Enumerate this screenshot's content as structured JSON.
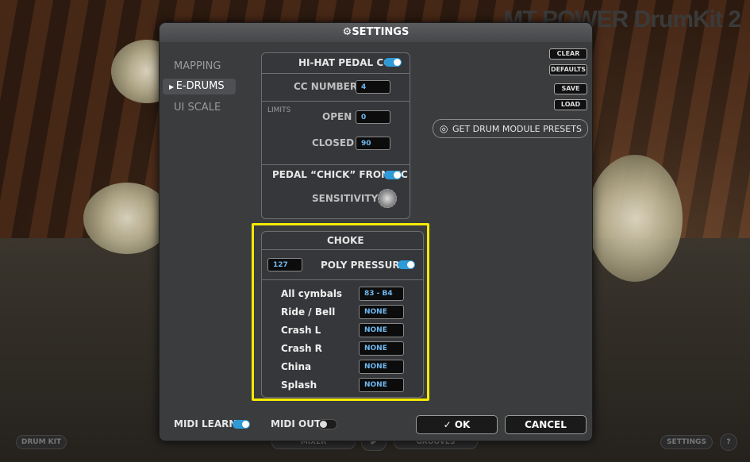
{
  "background": {
    "brand": "MT POWER DrumKit 2",
    "bottom_left_button": "DRUM KIT",
    "bottom_mixer": "MIXER",
    "bottom_grooves": "GROOVES",
    "bottom_settings": "SETTINGS",
    "bottom_help": "?"
  },
  "dialog": {
    "title": "SETTINGS",
    "nav": [
      {
        "label": "MAPPING",
        "active": false
      },
      {
        "label": "E-DRUMS",
        "active": true
      },
      {
        "label": "UI SCALE",
        "active": false
      }
    ],
    "hihat": {
      "pedal_cc_label": "HI-HAT PEDAL CC",
      "pedal_cc_on": true,
      "cc_number_label": "CC NUMBER",
      "cc_number_value": "4",
      "limits_label": "LIMITS",
      "open_label": "OPEN",
      "open_value": "0",
      "closed_label": "CLOSED",
      "closed_value": "90",
      "chick_label": "PEDAL “CHICK” FROM CC",
      "chick_on": true,
      "sensitivity_label": "SENSITIVITY"
    },
    "choke": {
      "title": "CHOKE",
      "threshold_value": "127",
      "poly_pressure_label": "POLY PRESSURE",
      "poly_pressure_on": true,
      "rows": [
        {
          "label": "All  cymbals",
          "value": "83 - B4"
        },
        {
          "label": "Ride / Bell",
          "value": "NONE"
        },
        {
          "label": "Crash L",
          "value": "NONE"
        },
        {
          "label": "Crash R",
          "value": "NONE"
        },
        {
          "label": "China",
          "value": "NONE"
        },
        {
          "label": "Splash",
          "value": "NONE"
        }
      ]
    },
    "side_buttons": {
      "clear": "CLEAR",
      "defaults": "DEFAULTS",
      "save": "SAVE",
      "load": "LOAD",
      "presets": "GET DRUM MODULE PRESETS"
    },
    "footer": {
      "midi_learn_label": "MIDI LEARN",
      "midi_learn_on": true,
      "midi_out_label": "MIDI OUT",
      "midi_out_on": false,
      "ok_label": "✓ OK",
      "cancel_label": "CANCEL"
    }
  },
  "colors": {
    "accent": "#2e9ad8",
    "highlight": "#f5ea00",
    "field_text": "#6fb8f0"
  }
}
